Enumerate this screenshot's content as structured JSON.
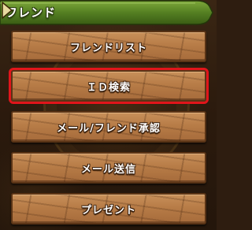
{
  "header": {
    "title": "フレンド",
    "arrow_icon": "triangle-right-icon",
    "color": "#4e7a1c"
  },
  "menu": {
    "items": [
      {
        "label": "フレンドリスト",
        "selected": false
      },
      {
        "label": "ＩＤ検索",
        "selected": true
      },
      {
        "label": "メール/フレンド承認",
        "selected": false
      },
      {
        "label": "メール送信",
        "selected": false
      },
      {
        "label": "プレゼント",
        "selected": false
      }
    ],
    "highlight_color": "#e0151b"
  }
}
